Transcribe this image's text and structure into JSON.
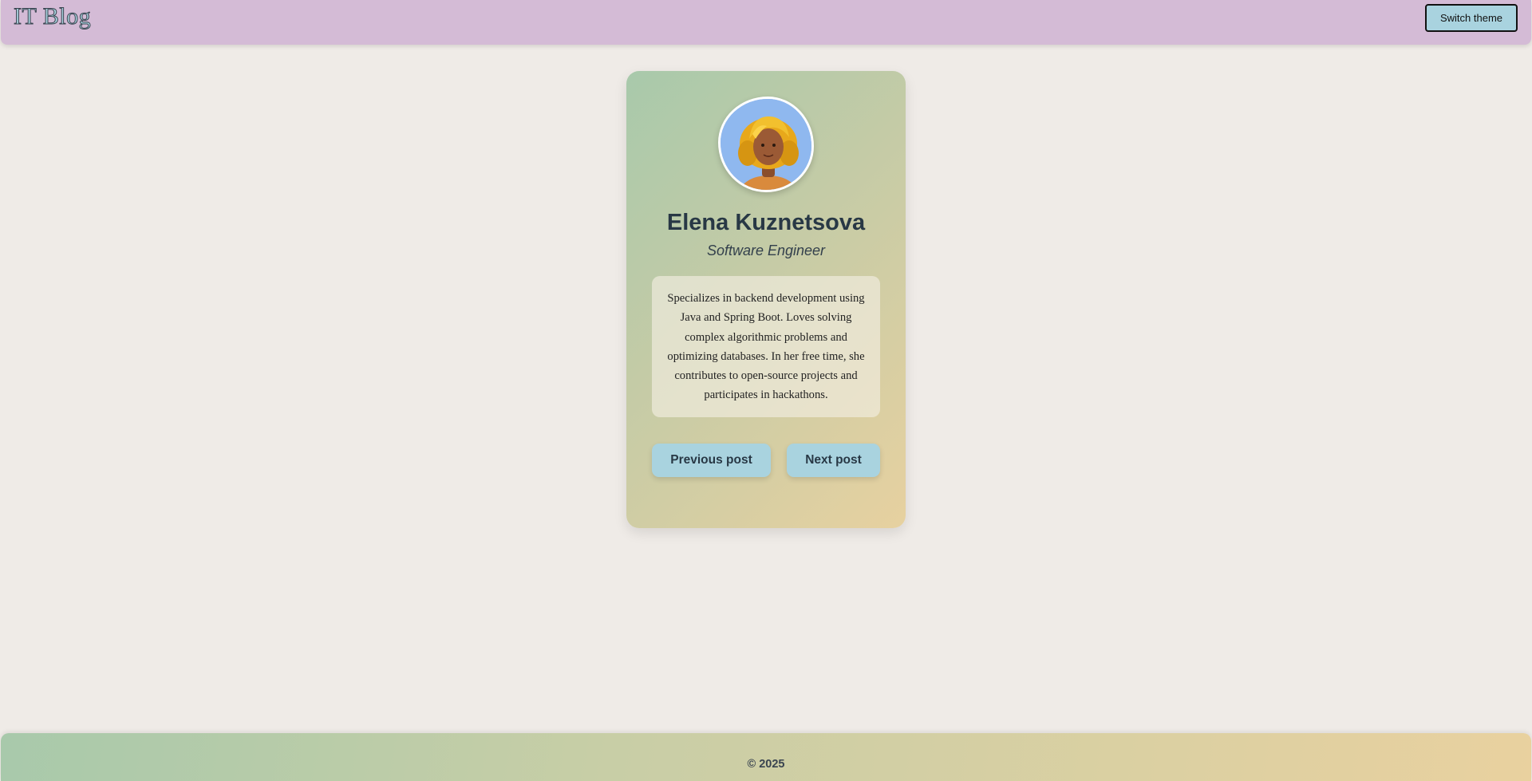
{
  "header": {
    "logo": "IT Blog",
    "theme_button": "Switch theme"
  },
  "profile": {
    "name": "Elena Kuznetsova",
    "role": "Software Engineer",
    "bio": "Specializes in backend development using Java and Spring Boot. Loves solving complex algorithmic problems and optimizing databases. In her free time, she contributes to open-source projects and participates in hackathons.",
    "avatar_icon": "woman-avatar-icon"
  },
  "navigation": {
    "prev_label": "Previous post",
    "next_label": "Next post"
  },
  "footer": {
    "copyright": "© 2025"
  },
  "colors": {
    "background": "#efebe7",
    "header": "#d4bbd6",
    "accent": "#a9d3df",
    "text_dark": "#283845"
  }
}
